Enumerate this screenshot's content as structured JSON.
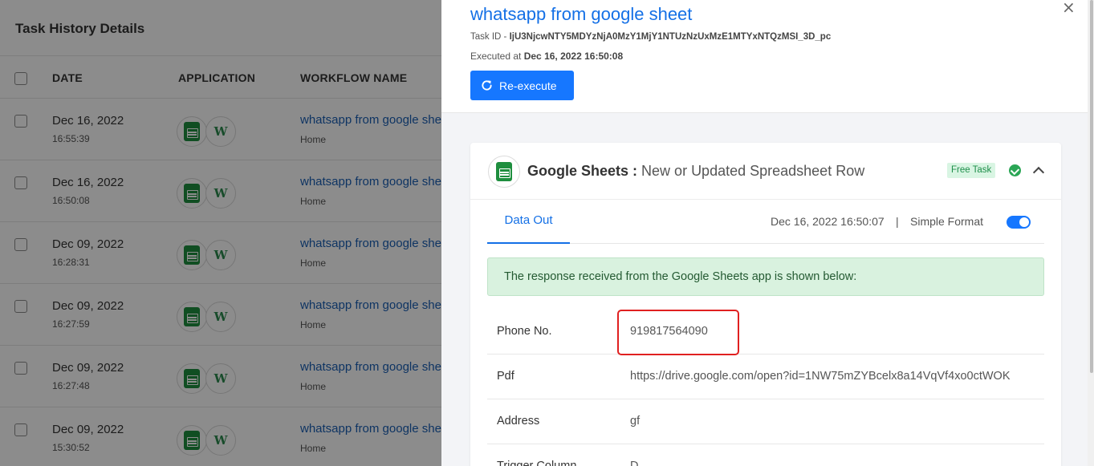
{
  "background": {
    "title": "Task History Details",
    "columns": [
      "DATE",
      "APPLICATION",
      "WORKFLOW NAME"
    ],
    "rows": [
      {
        "date": "Dec 16, 2022",
        "time": "16:55:39",
        "workflow": "whatsapp from google sheet",
        "sub": "Home"
      },
      {
        "date": "Dec 16, 2022",
        "time": "16:50:08",
        "workflow": "whatsapp from google sheet",
        "sub": "Home"
      },
      {
        "date": "Dec 09, 2022",
        "time": "16:28:31",
        "workflow": "whatsapp from google sheet",
        "sub": "Home"
      },
      {
        "date": "Dec 09, 2022",
        "time": "16:27:59",
        "workflow": "whatsapp from google sheet",
        "sub": "Home"
      },
      {
        "date": "Dec 09, 2022",
        "time": "16:27:48",
        "workflow": "whatsapp from google sheet",
        "sub": "Home"
      },
      {
        "date": "Dec 09, 2022",
        "time": "15:30:52",
        "workflow": "whatsapp from google sheet",
        "sub": "Home"
      }
    ]
  },
  "panel": {
    "title": "whatsapp from google sheet",
    "task_id_label": "Task ID - ",
    "task_id": "IjU3NjcwNTY5MDYzNjA0MzY1MjY1NTUzNzUxMzE1MTYxNTQzMSI_3D_pc",
    "executed_label": "Executed at ",
    "executed_at": "Dec 16, 2022 16:50:08",
    "reexecute_label": "Re-execute",
    "close_glyph": "×",
    "card": {
      "app_name": "Google Sheets :",
      "event_name": "New or Updated Spreadsheet Row",
      "badge": "Free Task",
      "tab_label": "Data Out",
      "tab_date": "Dec 16, 2022 16:50:07",
      "separator": "|",
      "format_label": "Simple Format",
      "alert_text": "The response received from the Google Sheets app is shown below:",
      "fields": [
        {
          "key": "Phone No.",
          "value": "919817564090"
        },
        {
          "key": "Pdf",
          "value": "https://drive.google.com/open?id=1NW75mZYBcelx8a14VqVf4xo0ctWOK"
        },
        {
          "key": "Address",
          "value": "gf"
        },
        {
          "key": "Trigger Column",
          "value": "D"
        }
      ]
    }
  },
  "colors": {
    "accent": "#1677ff",
    "link": "#1470e6",
    "success": "#2aa655",
    "highlight": "#e02020"
  },
  "icons": [
    "google-sheets-icon",
    "whatsapp-w-icon",
    "refresh-icon",
    "close-icon",
    "check-circle-icon",
    "chevron-up-icon"
  ]
}
